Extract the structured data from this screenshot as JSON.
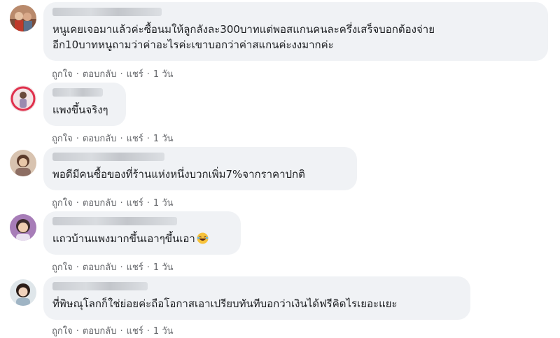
{
  "actions": {
    "like": "ถูกใจ",
    "reply": "ตอบกลับ",
    "share": "แชร์",
    "time": "1 วัน",
    "separator": "·"
  },
  "comments": [
    {
      "avatar_icon": "user-avatar-icon",
      "lines": [
        "หนูเคยเจอมาแล้วค่ะซื้อนมให้ลูกลังละ300บาทแต่พอสแกนคนละครึ่งเสร็จบอกต้องจ่าย",
        "อีก10บาทหนูถามว่าค่าอะไรค่ะเขาบอกว่าค่าสแกนค่ะงงมากค่ะ"
      ]
    },
    {
      "avatar_icon": "user-avatar-icon",
      "lines": [
        "แพงขึ้นจริงๆ"
      ]
    },
    {
      "avatar_icon": "user-avatar-icon",
      "lines": [
        "พอดีมีคนซื้อของที่ร้านแห่งหนึ่งบวกเพิ่ม7%จากราคาปกติ"
      ]
    },
    {
      "avatar_icon": "user-avatar-icon",
      "lines": [
        "แถวบ้านแพงมากขึ้นเอาๆขึ้นเอา"
      ],
      "emoji": "laughing-tears-emoji-icon"
    },
    {
      "avatar_icon": "user-avatar-icon",
      "lines": [
        "ที่พิษณุโลกก็ใช่ย่อยค่ะถือโอกาสเอาเปรียบทันทีบอกว่าเงินได้ฟรีคิดไรเยอะแยะ"
      ]
    }
  ]
}
